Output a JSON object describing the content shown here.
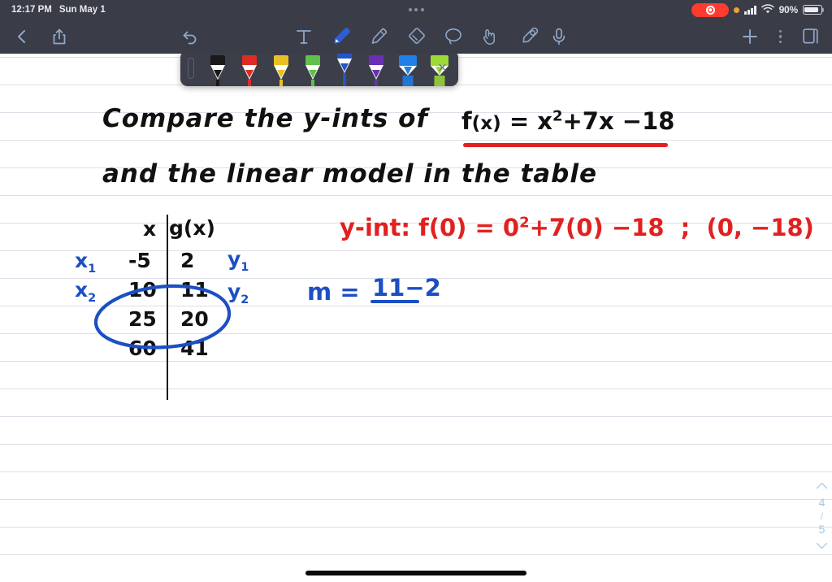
{
  "status_bar": {
    "time": "12:17 PM",
    "date": "Sun May 1",
    "battery_percent": "90%",
    "recording_indicator": "recording-pill",
    "privacy_dot": "microphone-in-use",
    "cellular": "signal-bars",
    "wifi": "wifi-icon"
  },
  "toolbar": {
    "back": "back-chevron",
    "share": "share-icon",
    "undo": "undo-icon",
    "mic": "microphone-icon",
    "add": "+",
    "more": "more-options",
    "pages": "pages-icon",
    "tools": [
      {
        "name": "text-tool",
        "label": "T",
        "selected": false
      },
      {
        "name": "pen-tool",
        "label": "pen",
        "selected": true
      },
      {
        "name": "highlighter-tool",
        "label": "highlighter",
        "selected": false
      },
      {
        "name": "eraser-tool",
        "label": "eraser",
        "selected": false
      },
      {
        "name": "lasso-tool",
        "label": "lasso",
        "selected": false
      },
      {
        "name": "scroll-tool",
        "label": "scroll-hand",
        "selected": false
      },
      {
        "name": "shape-tool",
        "label": "shape",
        "selected": false
      }
    ]
  },
  "pen_tray": {
    "close_label": "×",
    "pens": [
      {
        "name": "pen-black",
        "color": "#1a1a1a",
        "type": "pen",
        "selected": false
      },
      {
        "name": "pen-red",
        "color": "#e02b25",
        "type": "pen",
        "selected": false
      },
      {
        "name": "pen-yellow",
        "color": "#e8c020",
        "type": "pen",
        "selected": false
      },
      {
        "name": "pen-green",
        "color": "#5fc14a",
        "type": "pen",
        "selected": false
      },
      {
        "name": "pen-blue",
        "color": "#2255cc",
        "type": "pen",
        "selected": true
      },
      {
        "name": "pen-purple",
        "color": "#6a2fb5",
        "type": "pen",
        "selected": false
      },
      {
        "name": "highlighter-blue",
        "color": "#1f7fe8",
        "type": "highlighter",
        "selected": false
      },
      {
        "name": "highlighter-green",
        "color": "#9ddb34",
        "type": "highlighter",
        "selected": false
      },
      {
        "name": "highlighter-yellow",
        "color": "#ece02a",
        "type": "highlighter",
        "selected": false
      }
    ]
  },
  "note": {
    "line1": "Compare   the    y-ints   of",
    "line1_equation": "f(x) = x² + 7x −18",
    "line2": "and    the   linear    model    in   the   table",
    "yint_work": "y-int:  f(0) = 0² + 7(0) −18    ;   (0, −18)",
    "slope_label": "m =",
    "slope_numerator": "11−2",
    "table": {
      "header_x": "x",
      "header_y": "g(x)",
      "rows": [
        {
          "x": "-5",
          "y": "2"
        },
        {
          "x": "10",
          "y": "11"
        },
        {
          "x": "25",
          "y": "20"
        },
        {
          "x": "60",
          "y": "41"
        }
      ],
      "annotations": {
        "x1": "x₁",
        "x2": "x₂",
        "y1": "y₁",
        "y2": "y₂"
      }
    }
  },
  "page_nav": {
    "up": "⌃",
    "current": "4",
    "separator": "/",
    "total": "5",
    "down": "⌄"
  },
  "colors": {
    "chrome": "#3a3d48",
    "tool_icon": "#8fa7c8",
    "rule_line": "#dcdfe8",
    "ink_black": "#111111",
    "ink_blue": "#1b4fc4",
    "ink_red": "#e12121",
    "accent_record": "#ff3b30"
  }
}
